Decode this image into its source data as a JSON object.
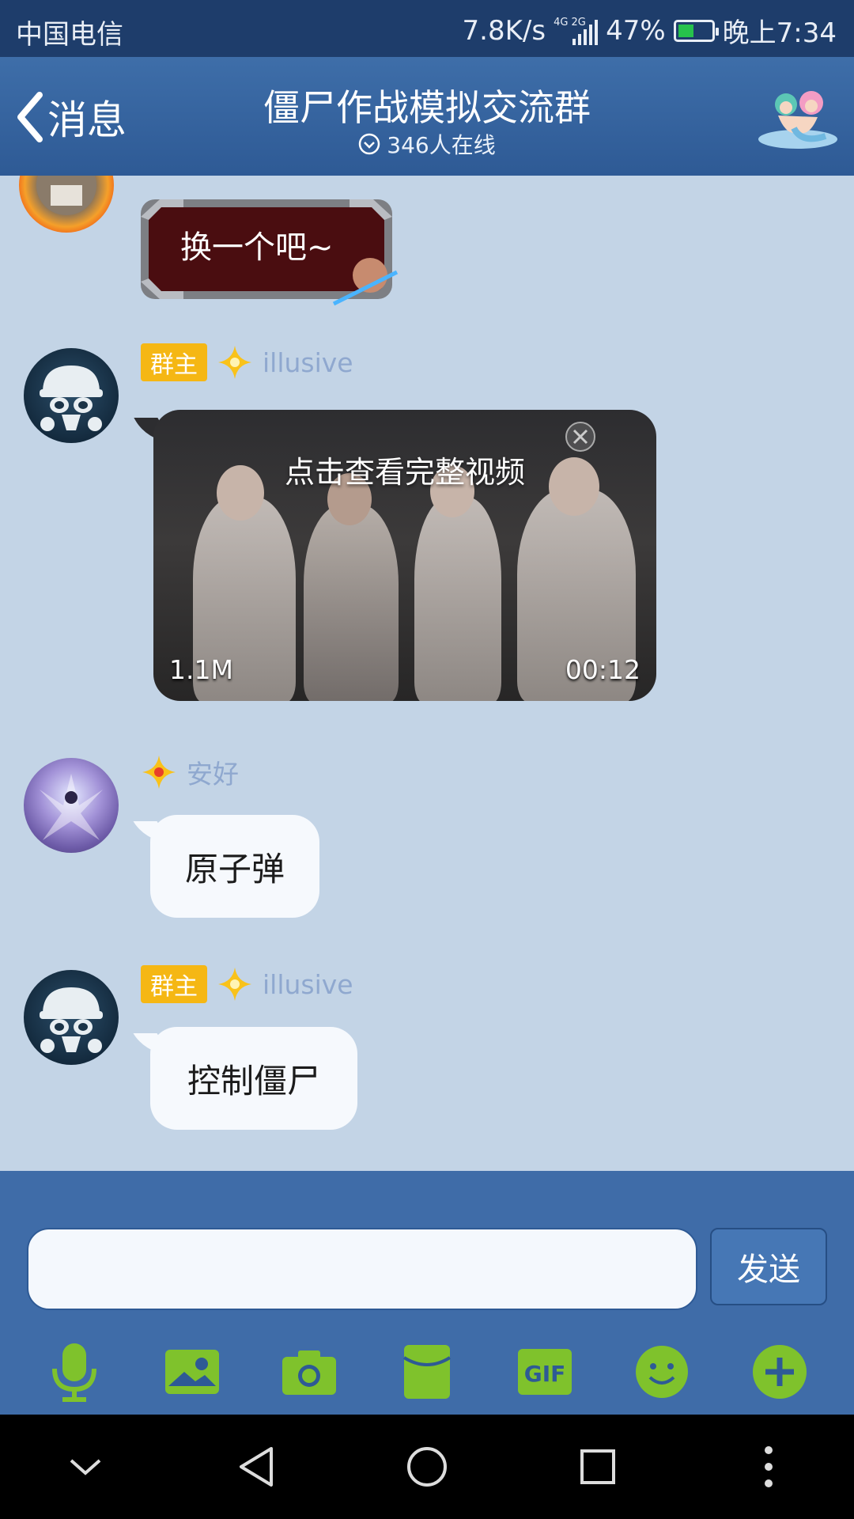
{
  "status_bar": {
    "carrier": "中国电信",
    "net_speed": "7.8K/s",
    "network_type": "4G 2G",
    "battery": "47%",
    "battery_level": 0.47,
    "time": "晚上7:34"
  },
  "header": {
    "back_label": "消息",
    "title": "僵尸作战模拟交流群",
    "online": "346人在线"
  },
  "messages": [
    {
      "kind": "sticker",
      "sticker_text": "换一个吧~"
    },
    {
      "kind": "video",
      "role_badge": "群主",
      "username": "illusive",
      "video_title": "点击查看完整视频",
      "video_size": "1.1M",
      "video_duration": "00:12"
    },
    {
      "kind": "text",
      "username": "安好",
      "text": "原子弹"
    },
    {
      "kind": "text",
      "role_badge": "群主",
      "username": "illusive",
      "text": "控制僵尸"
    }
  ],
  "composer": {
    "send_label": "发送"
  },
  "toolbar": {
    "gif_label": "GIF",
    "items": [
      "microphone-icon",
      "photo-album-icon",
      "camera-icon",
      "red-packet-icon",
      "gif-icon",
      "emoji-icon",
      "plus-icon"
    ]
  },
  "colors": {
    "header": "#3e6ea9",
    "status_bar": "#1e3d6b",
    "chat_background": "#c3d4e6",
    "owner_badge": "#f5b714",
    "tool_icon": "#7fc22c"
  }
}
